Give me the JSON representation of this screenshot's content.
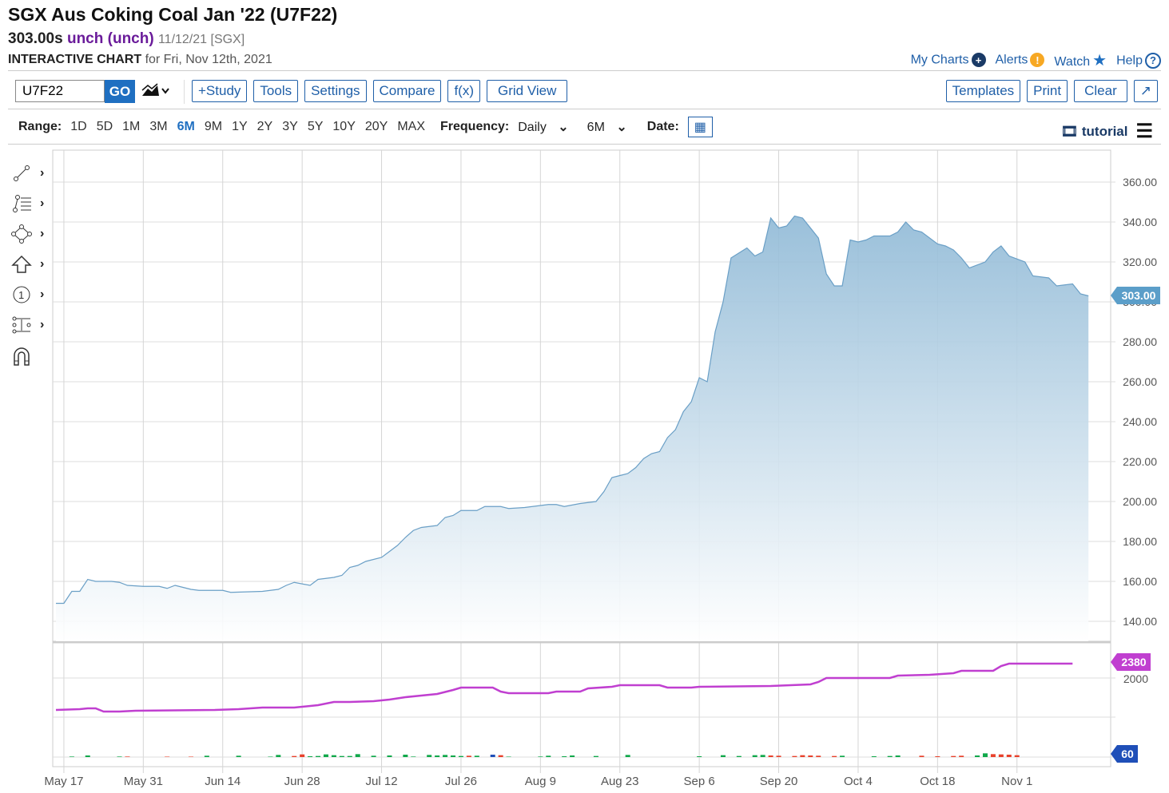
{
  "header": {
    "title": "SGX Aus Coking Coal Jan '22 (U7F22)",
    "price": "303.00s",
    "change": "unch (unch)",
    "date_exchange": "11/12/21 [SGX]",
    "chart_label": "INTERACTIVE CHART",
    "chart_for": "for Fri, Nov 12th, 2021"
  },
  "toplinks": [
    {
      "label": "My Charts",
      "icon": "plus-circle-icon"
    },
    {
      "label": "Alerts",
      "icon": "exclamation-icon"
    },
    {
      "label": "Watch",
      "icon": "star-icon"
    },
    {
      "label": "Help",
      "icon": "question-icon"
    }
  ],
  "toolbar": {
    "symbol": "U7F22",
    "go": "GO",
    "buttons": [
      "+Study",
      "Tools",
      "Settings",
      "Compare",
      "f(x)",
      "Grid View"
    ],
    "right_buttons": [
      "Templates",
      "Print",
      "Clear",
      "↗"
    ]
  },
  "range": {
    "label": "Range:",
    "options": [
      "1D",
      "5D",
      "1M",
      "3M",
      "6M",
      "9M",
      "1Y",
      "2Y",
      "3Y",
      "5Y",
      "10Y",
      "20Y",
      "MAX"
    ],
    "active": "6M",
    "frequency_label": "Frequency:",
    "frequency": "Daily",
    "period": "6M",
    "date_label": "Date:",
    "tutorial": "tutorial"
  },
  "colors": {
    "accent": "#1f6fc1",
    "area": "#8fb9d6",
    "oi": "#c03fd0",
    "up": "#10a84a",
    "down": "#e8412b",
    "neutral": "#1f4fb8"
  },
  "chart_data": {
    "type": "area",
    "x_unit": "trading day index (0 = May 14, 2021)",
    "x_ticks": [
      {
        "i": 1,
        "label": "May 17"
      },
      {
        "i": 11,
        "label": "May 31"
      },
      {
        "i": 21,
        "label": "Jun 14"
      },
      {
        "i": 31,
        "label": "Jun 28"
      },
      {
        "i": 41,
        "label": "Jul 12"
      },
      {
        "i": 51,
        "label": "Jul 26"
      },
      {
        "i": 61,
        "label": "Aug 9"
      },
      {
        "i": 71,
        "label": "Aug 23"
      },
      {
        "i": 81,
        "label": "Sep 6"
      },
      {
        "i": 91,
        "label": "Sep 20"
      },
      {
        "i": 101,
        "label": "Oct 4"
      },
      {
        "i": 111,
        "label": "Oct 18"
      },
      {
        "i": 121,
        "label": "Nov 1"
      }
    ],
    "price": {
      "ylim": [
        130,
        365
      ],
      "ticks": [
        "140.00",
        "160.00",
        "180.00",
        "200.00",
        "220.00",
        "240.00",
        "260.00",
        "280.00",
        "300.00",
        "320.00",
        "340.00",
        "360.00"
      ],
      "last": "303.00",
      "points": [
        [
          0,
          149
        ],
        [
          1,
          149
        ],
        [
          2,
          155
        ],
        [
          3,
          155
        ],
        [
          4,
          161
        ],
        [
          5,
          160
        ],
        [
          7,
          160
        ],
        [
          8,
          159.5
        ],
        [
          9,
          158
        ],
        [
          11,
          157.5
        ],
        [
          13,
          157.5
        ],
        [
          14,
          156.5
        ],
        [
          15,
          158
        ],
        [
          16,
          157
        ],
        [
          17,
          156
        ],
        [
          18,
          155.5
        ],
        [
          21,
          155.5
        ],
        [
          22,
          154.5
        ],
        [
          26,
          155
        ],
        [
          28,
          156
        ],
        [
          29,
          158
        ],
        [
          30,
          159.5
        ],
        [
          32,
          158
        ],
        [
          33,
          161
        ],
        [
          35,
          162
        ],
        [
          36,
          163
        ],
        [
          37,
          167
        ],
        [
          38,
          168
        ],
        [
          39,
          170
        ],
        [
          41,
          172
        ],
        [
          42,
          175
        ],
        [
          43,
          178
        ],
        [
          44,
          182
        ],
        [
          45,
          185.5
        ],
        [
          46,
          187
        ],
        [
          48,
          188
        ],
        [
          49,
          192
        ],
        [
          50,
          193
        ],
        [
          51,
          195.5
        ],
        [
          53,
          195.5
        ],
        [
          54,
          197.5
        ],
        [
          56,
          197.5
        ],
        [
          57,
          196.5
        ],
        [
          59,
          197
        ],
        [
          62,
          198.5
        ],
        [
          63,
          198.5
        ],
        [
          64,
          197.5
        ],
        [
          66,
          199
        ],
        [
          67,
          199.5
        ],
        [
          68,
          200
        ],
        [
          69,
          205
        ],
        [
          70,
          212
        ],
        [
          71,
          213
        ],
        [
          72,
          214
        ],
        [
          73,
          217
        ],
        [
          74,
          221.5
        ],
        [
          75,
          224
        ],
        [
          76,
          225
        ],
        [
          77,
          232
        ],
        [
          78,
          236
        ],
        [
          79,
          245
        ],
        [
          80,
          250
        ],
        [
          81,
          262
        ],
        [
          82,
          260
        ],
        [
          83,
          285
        ],
        [
          84,
          300
        ],
        [
          85,
          322
        ],
        [
          87,
          327
        ],
        [
          88,
          323
        ],
        [
          89,
          325
        ],
        [
          90,
          342
        ],
        [
          91,
          337
        ],
        [
          92,
          338
        ],
        [
          93,
          343
        ],
        [
          94,
          342
        ],
        [
          96,
          332
        ],
        [
          97,
          314
        ],
        [
          98,
          308
        ],
        [
          99,
          308
        ],
        [
          100,
          331
        ],
        [
          101,
          330
        ],
        [
          102,
          331
        ],
        [
          103,
          333
        ],
        [
          105,
          333
        ],
        [
          106,
          335
        ],
        [
          107,
          340
        ],
        [
          108,
          336
        ],
        [
          109,
          335
        ],
        [
          111,
          329
        ],
        [
          112,
          328
        ],
        [
          113,
          326
        ],
        [
          114,
          322
        ],
        [
          115,
          317
        ],
        [
          117,
          320
        ],
        [
          118,
          325
        ],
        [
          119,
          328
        ],
        [
          120,
          323
        ],
        [
          122,
          320
        ],
        [
          123,
          313
        ],
        [
          125,
          312
        ],
        [
          126,
          308
        ],
        [
          128,
          309
        ],
        [
          129,
          304
        ],
        [
          130,
          303
        ]
      ]
    },
    "open_interest": {
      "tick": "2000",
      "last": "2380",
      "points": [
        [
          0,
          1200
        ],
        [
          3,
          1220
        ],
        [
          4,
          1240
        ],
        [
          5,
          1240
        ],
        [
          6,
          1160
        ],
        [
          8,
          1160
        ],
        [
          10,
          1180
        ],
        [
          20,
          1200
        ],
        [
          23,
          1220
        ],
        [
          26,
          1260
        ],
        [
          30,
          1260
        ],
        [
          33,
          1320
        ],
        [
          35,
          1400
        ],
        [
          37,
          1400
        ],
        [
          40,
          1420
        ],
        [
          42,
          1460
        ],
        [
          44,
          1520
        ],
        [
          46,
          1560
        ],
        [
          48,
          1600
        ],
        [
          50,
          1700
        ],
        [
          51,
          1760
        ],
        [
          55,
          1760
        ],
        [
          56,
          1660
        ],
        [
          57,
          1620
        ],
        [
          62,
          1620
        ],
        [
          63,
          1660
        ],
        [
          66,
          1660
        ],
        [
          67,
          1740
        ],
        [
          70,
          1780
        ],
        [
          71,
          1820
        ],
        [
          76,
          1820
        ],
        [
          77,
          1760
        ],
        [
          80,
          1760
        ],
        [
          81,
          1780
        ],
        [
          90,
          1800
        ],
        [
          95,
          1840
        ],
        [
          96,
          1900
        ],
        [
          97,
          2000
        ],
        [
          105,
          2000
        ],
        [
          106,
          2060
        ],
        [
          110,
          2080
        ],
        [
          113,
          2120
        ],
        [
          114,
          2180
        ],
        [
          118,
          2180
        ],
        [
          119,
          2300
        ],
        [
          120,
          2360
        ],
        [
          128,
          2360
        ]
      ]
    },
    "volume": {
      "last": "60",
      "bars": [
        [
          2,
          10,
          "up"
        ],
        [
          4,
          30,
          "up"
        ],
        [
          8,
          10,
          "up"
        ],
        [
          9,
          10,
          "down"
        ],
        [
          14,
          8,
          "down"
        ],
        [
          17,
          8,
          "down"
        ],
        [
          19,
          25,
          "up"
        ],
        [
          23,
          25,
          "up"
        ],
        [
          27,
          8,
          "up"
        ],
        [
          28,
          40,
          "up"
        ],
        [
          30,
          20,
          "down"
        ],
        [
          31,
          50,
          "down"
        ],
        [
          32,
          15,
          "up"
        ],
        [
          33,
          20,
          "up"
        ],
        [
          34,
          50,
          "up"
        ],
        [
          35,
          35,
          "up"
        ],
        [
          36,
          20,
          "up"
        ],
        [
          37,
          20,
          "up"
        ],
        [
          38,
          55,
          "up"
        ],
        [
          40,
          25,
          "up"
        ],
        [
          42,
          30,
          "up"
        ],
        [
          44,
          45,
          "up"
        ],
        [
          45,
          10,
          "up"
        ],
        [
          47,
          40,
          "up"
        ],
        [
          48,
          30,
          "up"
        ],
        [
          49,
          40,
          "up"
        ],
        [
          50,
          30,
          "up"
        ],
        [
          51,
          20,
          "up"
        ],
        [
          52,
          25,
          "down"
        ],
        [
          53,
          25,
          "up"
        ],
        [
          55,
          45,
          "neutral"
        ],
        [
          56,
          35,
          "down"
        ],
        [
          57,
          8,
          "up"
        ],
        [
          61,
          10,
          "up"
        ],
        [
          62,
          25,
          "up"
        ],
        [
          64,
          15,
          "up"
        ],
        [
          65,
          30,
          "up"
        ],
        [
          68,
          20,
          "up"
        ],
        [
          72,
          40,
          "up"
        ],
        [
          81,
          15,
          "up"
        ],
        [
          84,
          35,
          "up"
        ],
        [
          86,
          20,
          "up"
        ],
        [
          88,
          35,
          "up"
        ],
        [
          89,
          40,
          "up"
        ],
        [
          90,
          30,
          "down"
        ],
        [
          91,
          25,
          "down"
        ],
        [
          93,
          20,
          "down"
        ],
        [
          94,
          35,
          "down"
        ],
        [
          95,
          30,
          "down"
        ],
        [
          96,
          25,
          "down"
        ],
        [
          98,
          20,
          "down"
        ],
        [
          99,
          25,
          "up"
        ],
        [
          103,
          15,
          "up"
        ],
        [
          105,
          20,
          "up"
        ],
        [
          106,
          30,
          "up"
        ],
        [
          109,
          25,
          "down"
        ],
        [
          111,
          15,
          "down"
        ],
        [
          113,
          20,
          "down"
        ],
        [
          114,
          25,
          "down"
        ],
        [
          116,
          30,
          "up"
        ],
        [
          117,
          70,
          "up"
        ],
        [
          118,
          55,
          "down"
        ],
        [
          119,
          50,
          "down"
        ],
        [
          120,
          45,
          "down"
        ],
        [
          121,
          35,
          "down"
        ]
      ]
    }
  }
}
